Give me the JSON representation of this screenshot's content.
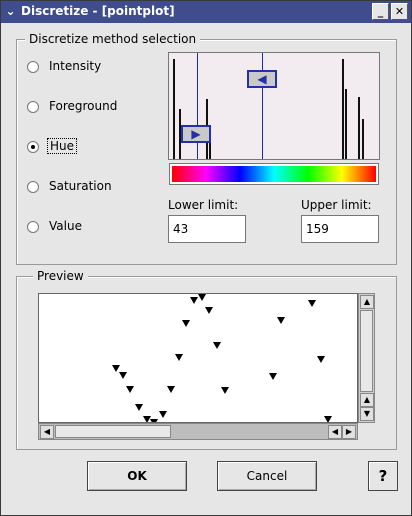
{
  "window": {
    "title": "Discretize - [pointplot]",
    "menu_icon": "chevron-down-icon",
    "minimize_icon": "minimize-icon",
    "close_icon": "close-icon",
    "minimize_glyph": "_",
    "close_glyph": "✕",
    "menu_glyph": "⌄"
  },
  "method_group": {
    "legend": "Discretize method selection",
    "options": [
      {
        "label": "Intensity",
        "selected": false
      },
      {
        "label": "Foreground",
        "selected": false
      },
      {
        "label": "Hue",
        "selected": true
      },
      {
        "label": "Saturation",
        "selected": false
      },
      {
        "label": "Value",
        "selected": false
      }
    ]
  },
  "limits": {
    "lower_label": "Lower limit:",
    "lower_value": "43",
    "upper_label": "Upper limit:",
    "upper_value": "159"
  },
  "histogram": {
    "lower_handle_glyph": "▶",
    "upper_handle_glyph": "◀"
  },
  "preview": {
    "legend": "Preview",
    "marker_glyph": "▼"
  },
  "buttons": {
    "ok": "OK",
    "cancel": "Cancel",
    "help_glyph": "?"
  },
  "colors": {
    "titlebar": "#3f4d8f",
    "accent": "#2330a8",
    "window_bg": "#e6e6e6"
  }
}
